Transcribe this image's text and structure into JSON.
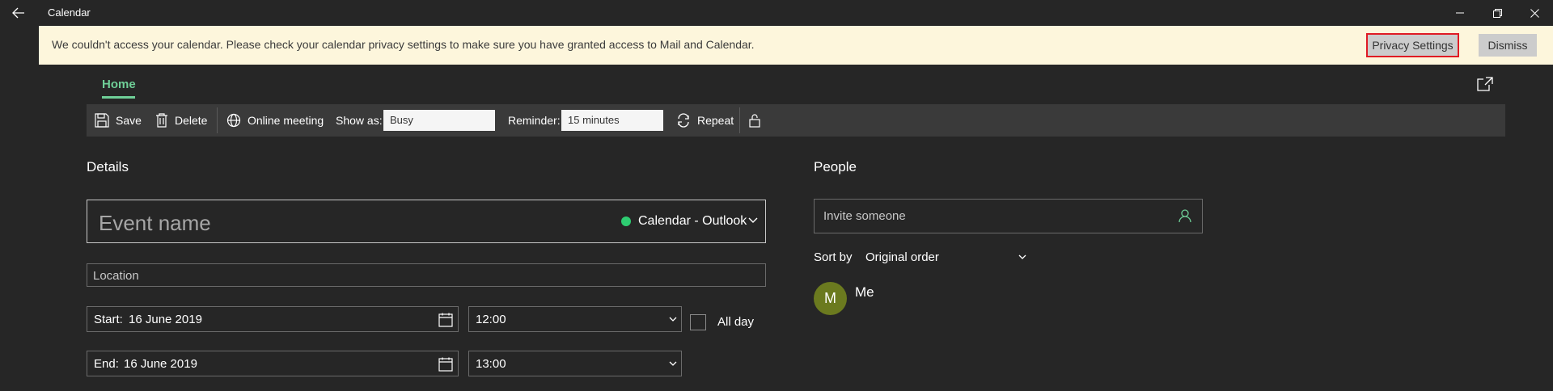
{
  "window": {
    "title": "Calendar",
    "back_icon": "back-arrow-icon",
    "minimize_icon": "minimize-icon",
    "restore_icon": "restore-icon",
    "close_icon": "close-icon"
  },
  "banner": {
    "message": "We couldn't access your calendar. Please check your calendar privacy settings to make sure you have granted access to Mail and Calendar.",
    "privacy_button": "Privacy Settings",
    "dismiss_button": "Dismiss"
  },
  "tabs": {
    "home": "Home",
    "popout_icon": "popout-icon"
  },
  "toolbar": {
    "save": "Save",
    "delete": "Delete",
    "online_meeting": "Online meeting",
    "show_as_label": "Show as:",
    "show_as_value": "Busy",
    "reminder_label": "Reminder:",
    "reminder_value": "15 minutes",
    "repeat": "Repeat",
    "lock_icon": "lock-icon"
  },
  "details": {
    "title": "Details",
    "event_name_placeholder": "Event name",
    "calendar_name": "Calendar - Outlook",
    "location_placeholder": "Location",
    "start_label": "Start:",
    "start_date": "16 June 2019",
    "start_time": "12:00",
    "all_day_label": "All day",
    "end_label": "End:",
    "end_date": "16 June 2019",
    "end_time": "13:00"
  },
  "people": {
    "title": "People",
    "invite_placeholder": "Invite someone",
    "sort_label": "Sort by",
    "sort_value": "Original order",
    "attendee_initial": "M",
    "attendee_name": "Me"
  },
  "colors": {
    "accent_green": "#6fcf97",
    "calendar_dot": "#2ecc71",
    "banner_bg": "#fdf6dc",
    "highlight_border": "#e01b24",
    "avatar_bg": "#6b7a1f"
  }
}
